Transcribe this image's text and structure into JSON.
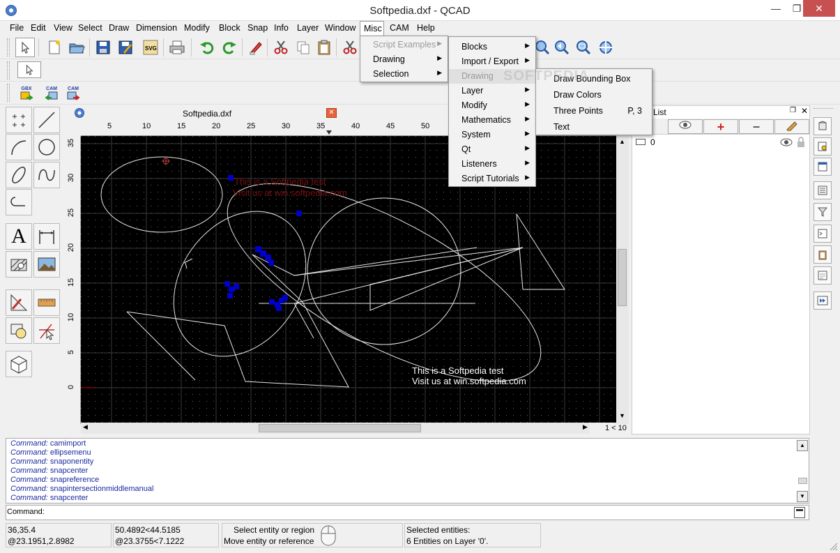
{
  "window": {
    "title": "Softpedia.dxf - QCAD"
  },
  "menubar": [
    "File",
    "Edit",
    "View",
    "Select",
    "Draw",
    "Dimension",
    "Modify",
    "Block",
    "Snap",
    "Info",
    "Layer",
    "Window",
    "Misc",
    "CAM",
    "Help"
  ],
  "toolbar3": {
    "gbx_label": "GBX",
    "cam1_label": "CAM",
    "cam2_label": "CAM"
  },
  "document": {
    "title": "Softpedia.dxf",
    "ruler_x": [
      "5",
      "10",
      "15",
      "20",
      "25",
      "30",
      "35",
      "40",
      "45",
      "50"
    ],
    "ruler_y": [
      "35",
      "30",
      "25",
      "20",
      "15",
      "10",
      "5",
      "0"
    ],
    "canvas_text_1": "This is a Softpedia test",
    "canvas_text_2": "Visit us at win.softpedia.com",
    "ghost_text_1": "This is a Softpedia test",
    "ghost_text_2": "Visit us at win.softpedia.com",
    "scroll_info": "1 < 10"
  },
  "tool_palette": {
    "text_tool_glyph": "A"
  },
  "layer_panel": {
    "title": "List",
    "layers": [
      {
        "name": "0"
      }
    ]
  },
  "misc_menu": {
    "items": [
      {
        "label": "Script Examples",
        "disabled": true
      },
      {
        "label": "Drawing"
      },
      {
        "label": "Selection"
      }
    ]
  },
  "script_menu": {
    "items": [
      "Blocks",
      "Import / Export",
      "Drawing",
      "Layer",
      "Modify",
      "Mathematics",
      "System",
      "Qt",
      "Listeners",
      "Script Tutorials"
    ]
  },
  "drawing_submenu": {
    "items": [
      {
        "label": "Draw Bounding Box",
        "shortcut": ""
      },
      {
        "label": "Draw Colors",
        "shortcut": ""
      },
      {
        "label": "Three Points",
        "shortcut": "P, 3"
      },
      {
        "label": "Text",
        "shortcut": ""
      }
    ]
  },
  "command_history": [
    {
      "prefix": "Command:",
      "cmd": "camimport"
    },
    {
      "prefix": "Command:",
      "cmd": "ellipsemenu"
    },
    {
      "prefix": "Command:",
      "cmd": "snaponentity"
    },
    {
      "prefix": "Command:",
      "cmd": "snapcenter"
    },
    {
      "prefix": "Command:",
      "cmd": "snapreference"
    },
    {
      "prefix": "Command:",
      "cmd": "snapintersectionmiddlemanual"
    },
    {
      "prefix": "Command:",
      "cmd": "snapcenter"
    }
  ],
  "command_input": {
    "label": "Command:"
  },
  "status": {
    "abs_coord": "36,35.4",
    "rel_coord": "@23.1951,2.8982",
    "polar_abs": "50.4892<44.5185",
    "polar_rel": "@23.3755<7.1222",
    "mouse_left": "Select entity or region",
    "mouse_right": "Move entity or reference",
    "sel_title": "Selected entities:",
    "sel_info": "6 Entities on Layer '0'."
  },
  "watermark": "SOFTPEDIA"
}
